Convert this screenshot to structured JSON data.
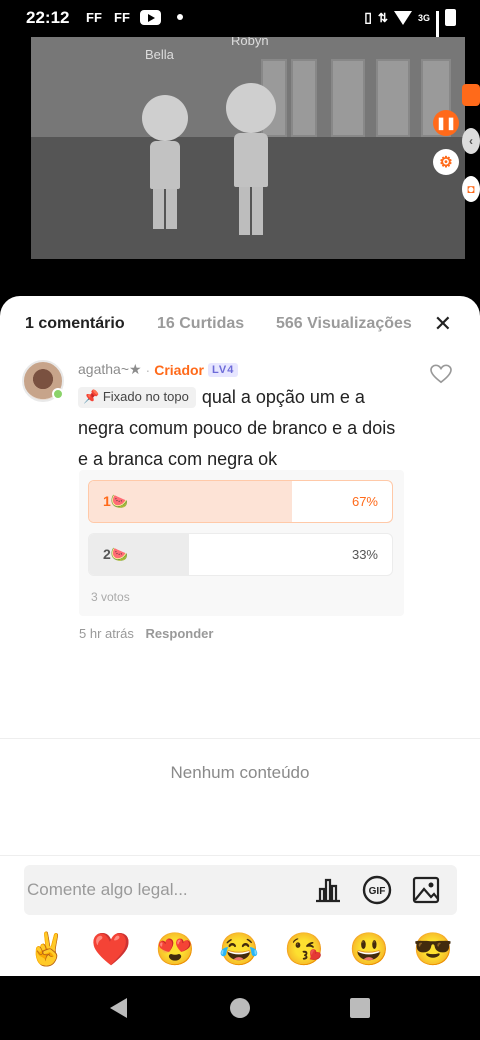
{
  "status_bar": {
    "time": "22:12",
    "notif_icons": [
      "FF",
      "FF"
    ],
    "network": "3G"
  },
  "video": {
    "char_names": [
      "Bella",
      "Robyn"
    ]
  },
  "tabs": [
    {
      "label": "1 comentário",
      "active": true
    },
    {
      "label": "16 Curtidas",
      "active": false
    },
    {
      "label": "566 Visualizações",
      "active": false
    }
  ],
  "comment": {
    "username": "agatha~★",
    "separator": "·",
    "role": "Criador",
    "level": "LV4",
    "pinned_label": "Fixado no topo",
    "text": "qual a opção um e a negra comum pouco de branco e a dois e a branca com negra ok",
    "poll": {
      "options": [
        {
          "label": "1🍉",
          "percent": "67%",
          "share": 0.67
        },
        {
          "label": "2🍉",
          "percent": "33%",
          "share": 0.33
        }
      ],
      "votes": "3 votos"
    },
    "time": "5 hr atrás",
    "reply_label": "Responder"
  },
  "empty_text": "Nenhum conteúdo",
  "input": {
    "placeholder": "Comente algo legal..."
  },
  "input_icons": [
    "bar-chart-icon",
    "gif-icon",
    "image-icon"
  ],
  "emojis": [
    "✌️",
    "❤️",
    "😍",
    "😂",
    "😘",
    "😃",
    "😎"
  ],
  "colors": {
    "accent": "#ff6a1a",
    "level_badge": "#6d6bd8"
  }
}
